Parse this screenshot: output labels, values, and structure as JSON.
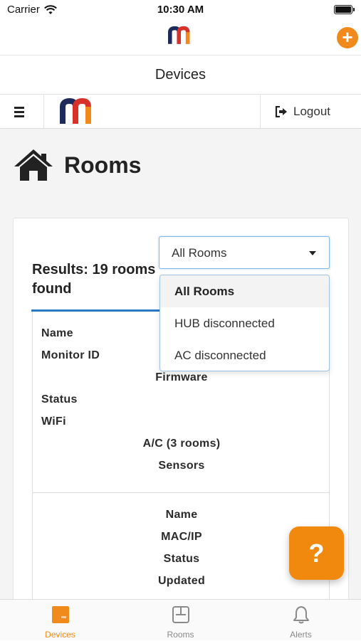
{
  "status_bar": {
    "carrier": "Carrier",
    "time": "10:30 AM"
  },
  "app_header": {
    "add_button_label": "+"
  },
  "nav": {
    "title": "Devices"
  },
  "web_nav": {
    "logout_label": "Logout"
  },
  "page": {
    "heading": "Rooms",
    "results_text": "Results: 19 rooms found"
  },
  "filter": {
    "selected": "All Rooms",
    "options": [
      "All Rooms",
      "HUB disconnected",
      "AC disconnected"
    ]
  },
  "table": {
    "section1": [
      "Name",
      "Monitor ID",
      "Firmware",
      "Status",
      "WiFi",
      "A/C (3 rooms)",
      "Sensors"
    ],
    "section2": [
      "Name",
      "MAC/IP",
      "Status",
      "Updated"
    ]
  },
  "help_button": {
    "label": "?"
  },
  "tab_bar": {
    "tabs": [
      {
        "label": "Devices",
        "active": true
      },
      {
        "label": "Rooms",
        "active": false
      },
      {
        "label": "Alerts",
        "active": false
      }
    ]
  },
  "colors": {
    "accent_orange": "#f08a1c",
    "brand_navy": "#1e2a5a",
    "brand_red": "#d8312a",
    "focus_blue": "#2a78c8"
  },
  "icons": {
    "wifi": "wifi-icon",
    "battery": "battery-icon",
    "logo": "brand-logo",
    "add": "plus-icon",
    "menu": "hamburger-icon",
    "logout": "logout-icon",
    "home": "home-icon",
    "caret": "chevron-down-icon",
    "tab_devices": "device-square-icon",
    "tab_rooms": "room-layout-icon",
    "tab_alerts": "bell-icon"
  }
}
